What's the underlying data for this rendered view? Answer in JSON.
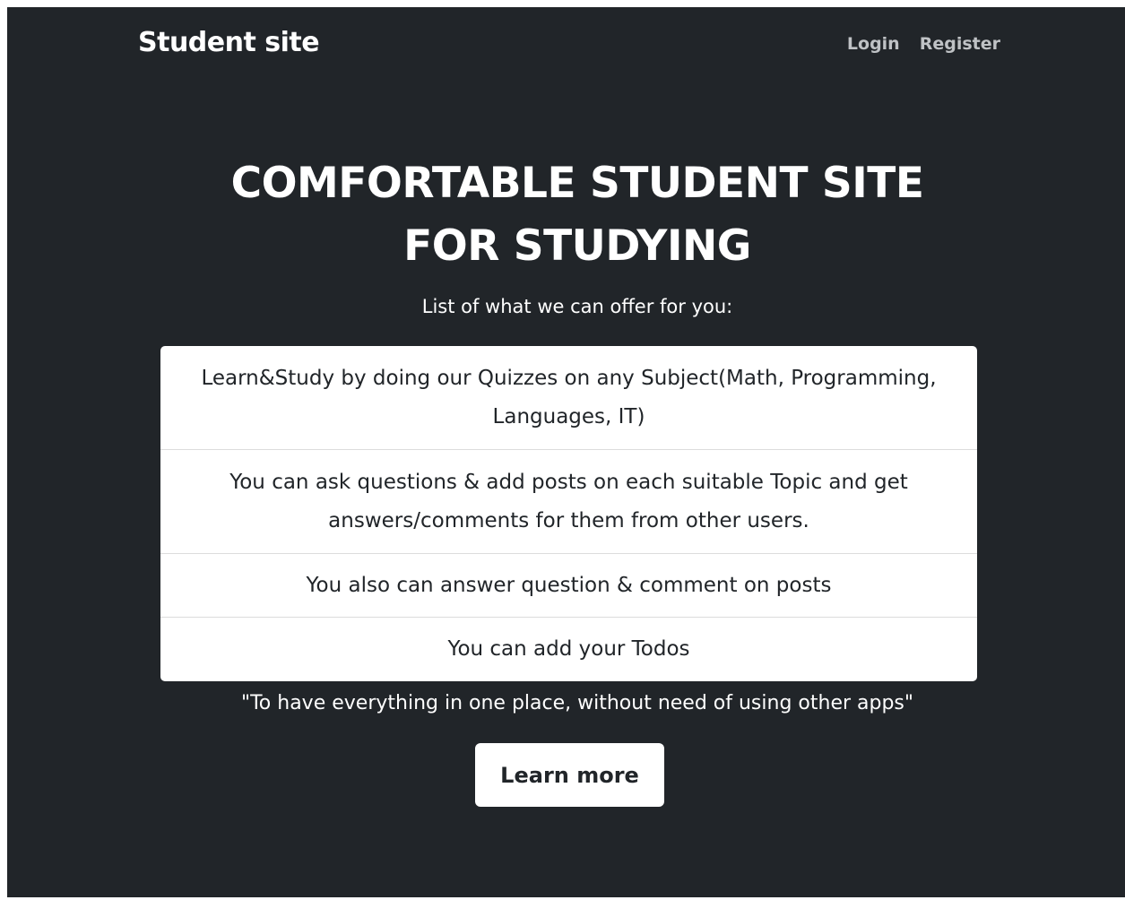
{
  "navbar": {
    "brand": "Student site",
    "links": [
      "Login",
      "Register"
    ]
  },
  "hero": {
    "title_line1": "COMFORTABLE STUDENT SITE",
    "title_line2": "FOR STUDYING",
    "subtitle": "List of what we can offer for you:"
  },
  "offers": [
    "Learn&Study by doing our Quizzes on any Subject(Math, Programming, Languages, IT)",
    "You can ask questions & add posts on each suitable Topic and get answers/comments for them from other users.",
    "You also can answer question & comment on posts",
    "You can add your Todos"
  ],
  "quote": "\"To have everything in one place, without need of using other apps\"",
  "cta": {
    "label": "Learn more"
  },
  "colors": {
    "background": "#212529",
    "text": "#ffffff",
    "nav_link": "#bfc2c5",
    "card": "#ffffff"
  }
}
